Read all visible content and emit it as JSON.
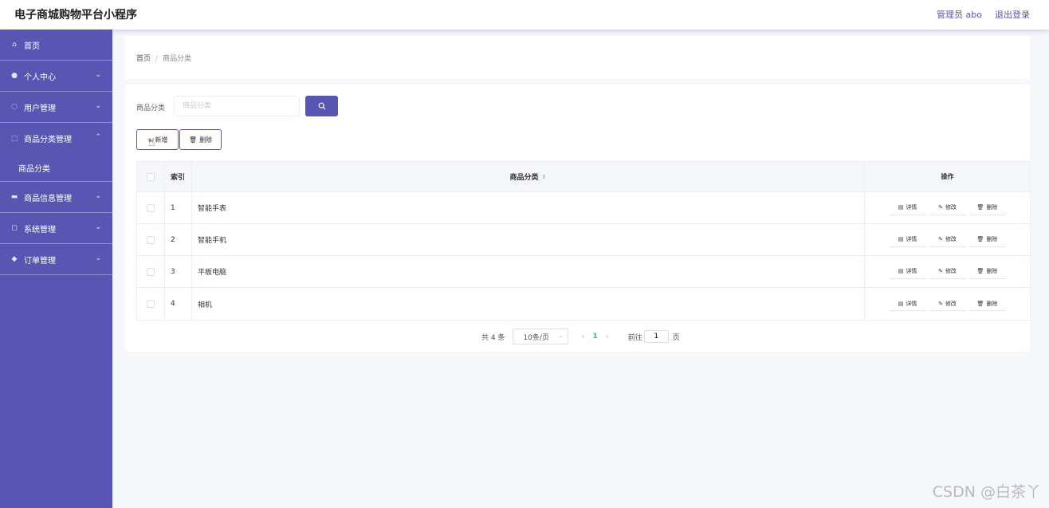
{
  "header": {
    "title": "电子商城购物平台小程序",
    "user": "管理员 abo",
    "logout": "退出登录"
  },
  "sidebar": {
    "items": [
      {
        "label": "首页",
        "icon": "home-icon",
        "glyph": "⌂",
        "expandable": false
      },
      {
        "label": "个人中心",
        "icon": "user-icon",
        "glyph": "●",
        "expandable": true
      },
      {
        "label": "用户管理",
        "icon": "users-icon",
        "glyph": "◌",
        "expandable": true
      },
      {
        "label": "商品分类管理",
        "icon": "category-icon",
        "glyph": "⬚",
        "expandable": true,
        "expanded": true
      },
      {
        "label": "商品信息管理",
        "icon": "product-icon",
        "glyph": "▬",
        "expandable": true
      },
      {
        "label": "系统管理",
        "icon": "system-icon",
        "glyph": "◻",
        "expandable": true
      },
      {
        "label": "订单管理",
        "icon": "order-icon",
        "glyph": "◆",
        "expandable": true
      }
    ],
    "sub_items": [
      {
        "label": "商品分类"
      }
    ]
  },
  "breadcrumb": {
    "home": "首页",
    "current": "商品分类"
  },
  "search": {
    "label": "商品分类",
    "placeholder": "商品分类"
  },
  "toolbar": {
    "add_label": "新增",
    "delete_label": "删除"
  },
  "table": {
    "headers": {
      "index": "索引",
      "name": "商品分类",
      "actions": "操作"
    },
    "action_labels": {
      "detail": "详情",
      "edit": "修改",
      "delete": "删除"
    },
    "rows": [
      {
        "index": "1",
        "name": "智能手表"
      },
      {
        "index": "2",
        "name": "智能手机"
      },
      {
        "index": "3",
        "name": "平板电脑"
      },
      {
        "index": "4",
        "name": "相机"
      }
    ]
  },
  "pagination": {
    "total": "共 4 条",
    "page_size": "10条/页",
    "current_page": "1",
    "goto_label": "前往",
    "goto_value": "1",
    "page_suffix": "页"
  },
  "watermark": "CSDN @白茶丫",
  "colors": {
    "accent": "#5856b2",
    "current_page": "#33b5a0"
  }
}
